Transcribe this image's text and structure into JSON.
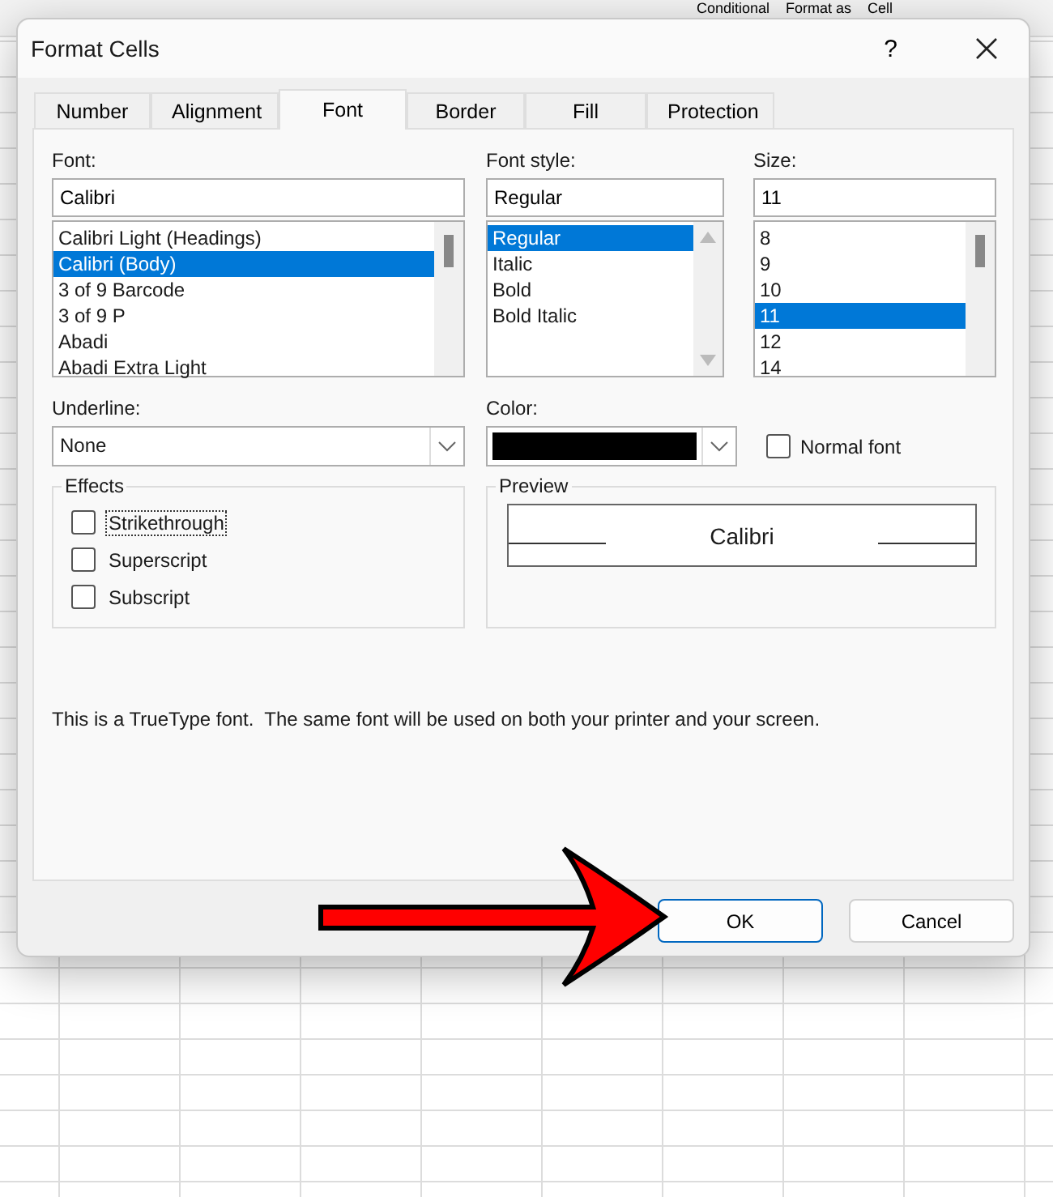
{
  "ribbon": {
    "labels": [
      "Conditional",
      "Format as",
      "Cell"
    ]
  },
  "window": {
    "title": "Format Cells",
    "help": "?"
  },
  "tabs": [
    {
      "label": "Number",
      "selected": false
    },
    {
      "label": "Alignment",
      "selected": false
    },
    {
      "label": "Font",
      "selected": true
    },
    {
      "label": "Border",
      "selected": false
    },
    {
      "label": "Fill",
      "selected": false
    },
    {
      "label": "Protection",
      "selected": false
    }
  ],
  "font": {
    "label": "Font:",
    "value": "Calibri",
    "items": [
      {
        "label": "Calibri Light (Headings)",
        "selected": false
      },
      {
        "label": "Calibri (Body)",
        "selected": true
      },
      {
        "label": "3 of 9 Barcode",
        "selected": false
      },
      {
        "label": "3 of 9 P",
        "selected": false
      },
      {
        "label": "Abadi",
        "selected": false
      },
      {
        "label": "Abadi Extra Light",
        "selected": false
      }
    ]
  },
  "font_style": {
    "label": "Font style:",
    "value": "Regular",
    "items": [
      {
        "label": "Regular",
        "selected": true
      },
      {
        "label": "Italic",
        "selected": false
      },
      {
        "label": "Bold",
        "selected": false
      },
      {
        "label": "Bold Italic",
        "selected": false
      }
    ]
  },
  "size": {
    "label": "Size:",
    "value": "11",
    "items": [
      {
        "label": "8",
        "selected": false
      },
      {
        "label": "9",
        "selected": false
      },
      {
        "label": "10",
        "selected": false
      },
      {
        "label": "11",
        "selected": true
      },
      {
        "label": "12",
        "selected": false
      },
      {
        "label": "14",
        "selected": false
      }
    ]
  },
  "underline": {
    "label": "Underline:",
    "value": "None"
  },
  "color": {
    "label": "Color:"
  },
  "normal_font": {
    "label": "Normal font",
    "checked": false
  },
  "effects": {
    "title": "Effects",
    "items": [
      {
        "label": "Strikethrough",
        "checked": false,
        "focused": true
      },
      {
        "label": "Superscript",
        "checked": false,
        "focused": false
      },
      {
        "label": "Subscript",
        "checked": false,
        "focused": false
      }
    ]
  },
  "preview": {
    "title": "Preview",
    "sample": "Calibri"
  },
  "note": "This is a TrueType font.  The same font will be used on both your printer and your screen.",
  "buttons": [
    {
      "label": "OK",
      "default": true
    },
    {
      "label": "Cancel",
      "default": false
    }
  ]
}
